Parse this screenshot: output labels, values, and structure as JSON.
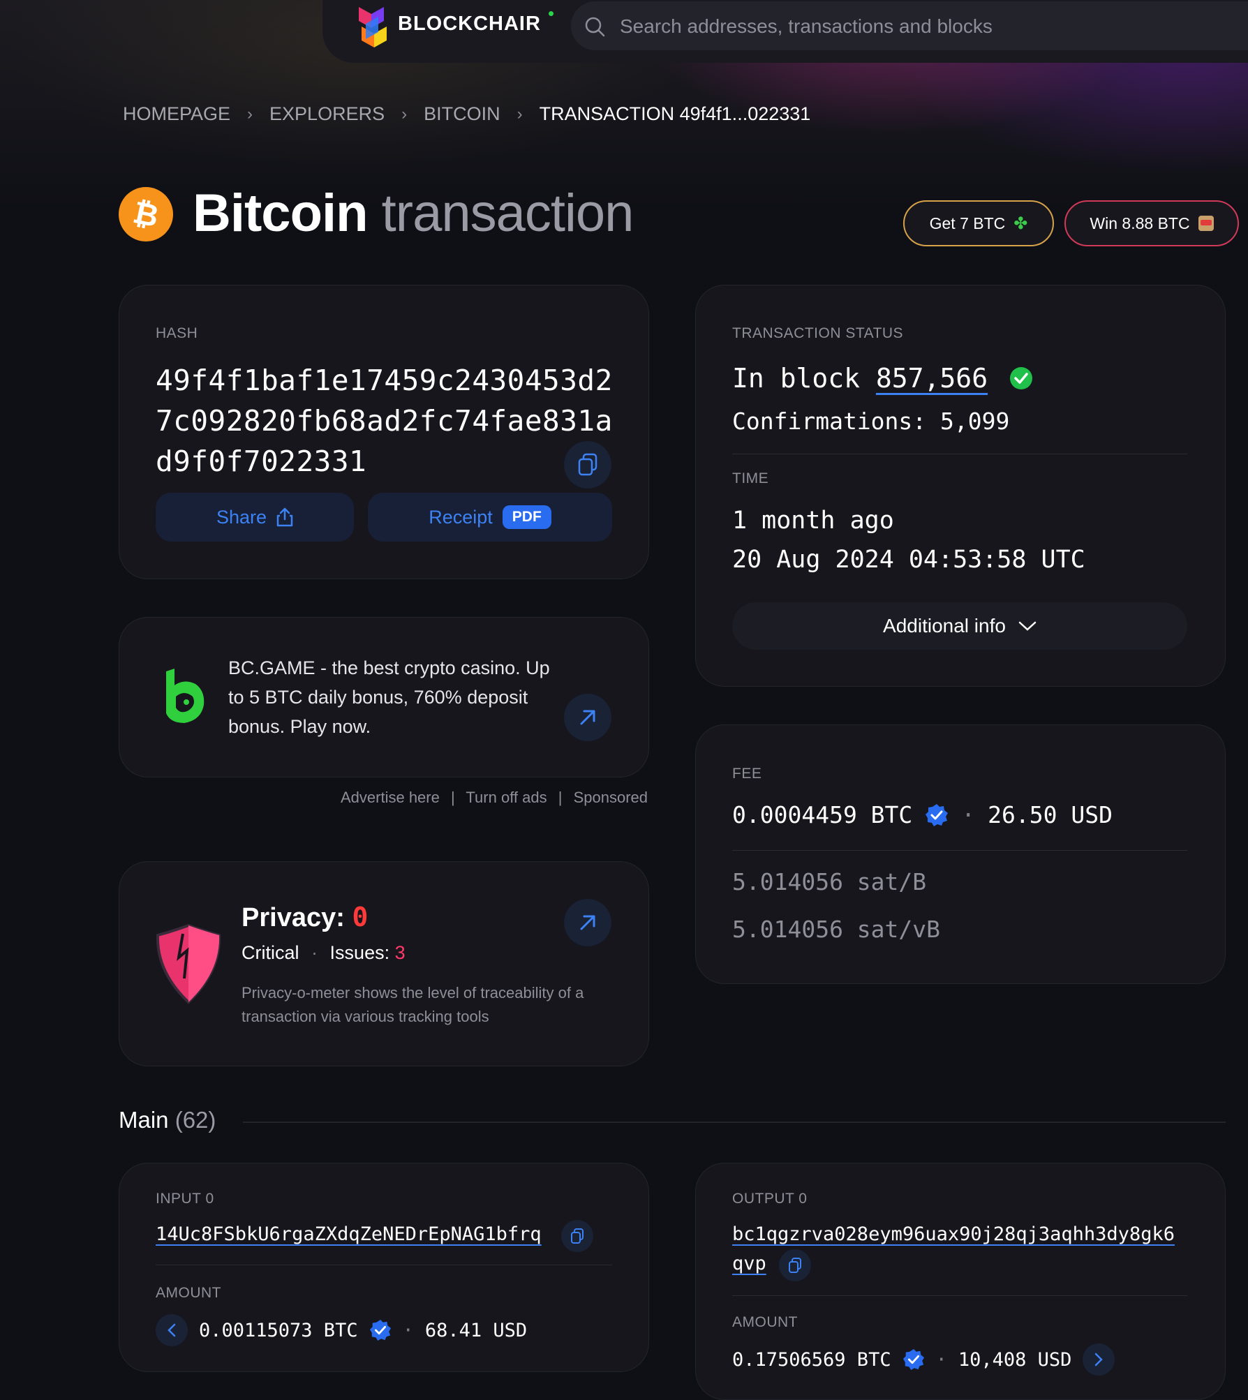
{
  "header": {
    "brand": "BLOCKCHAIR",
    "search_placeholder": "Search addresses, transactions and blocks"
  },
  "breadcrumb": [
    "HOMEPAGE",
    "EXPLORERS",
    "BITCOIN",
    "TRANSACTION 49f4f1...022331"
  ],
  "title": {
    "main": "Bitcoin",
    "sub": "transaction"
  },
  "promo": {
    "get": {
      "label": "Get 7 BTC",
      "icon": "clover-icon"
    },
    "win": {
      "label": "Win 8.88 BTC",
      "icon": "slot-machine-icon"
    }
  },
  "hash_card": {
    "label": "HASH",
    "hash": "49f4f1baf1e17459c2430453d27c092820fb68ad2fc74fae831ad9f0f7022331",
    "share_label": "Share",
    "receipt_label": "Receipt",
    "pdf_badge": "PDF"
  },
  "ad": {
    "text": "BC.GAME - the best crypto casino. Up to 5 BTC daily bonus, 760% deposit bonus. Play now.",
    "advertise": "Advertise here",
    "turn_off": "Turn off ads",
    "sponsored": "Sponsored",
    "divider": "|"
  },
  "privacy": {
    "label": "Privacy:",
    "score": "0",
    "level": "Critical",
    "dot": "·",
    "issues_label": "Issues:",
    "issues_count": "3",
    "description": "Privacy-o-meter shows the level of traceability of a transaction via various tracking tools"
  },
  "status_card": {
    "label": "TRANSACTION STATUS",
    "in_block_prefix": "In block",
    "block": "857,566",
    "confirmations": "Confirmations: 5,099",
    "time_label": "TIME",
    "relative": "1 month ago",
    "absolute": "20 Aug 2024 04:53:58 UTC",
    "additional_info": "Additional info"
  },
  "fee_card": {
    "label": "FEE",
    "btc": "0.0004459 BTC",
    "usd": "26.50 USD",
    "sat_per_b": "5.014056 sat/B",
    "sat_per_vb": "5.014056 sat/vB",
    "sep": "·"
  },
  "main_section": {
    "label": "Main",
    "count": "(62)"
  },
  "input0": {
    "label": "INPUT 0",
    "address": "14Uc8FSbkU6rgaZXdqZeNEDrEpNAG1bfrq",
    "amount_label": "AMOUNT",
    "btc": "0.00115073 BTC",
    "usd": "68.41 USD",
    "sep": "·"
  },
  "output0": {
    "label": "OUTPUT 0",
    "address_line1": "bc1qgzrva028eym96uax90j28qj3aqhh3dy8gk6",
    "address_line2": "qvp",
    "amount_label": "AMOUNT",
    "btc": "0.17506569 BTC",
    "usd": "10,408 USD",
    "sep": "·"
  },
  "colors": {
    "background": "#0f1016",
    "accent_blue": "#3d82f5",
    "success_green": "#20c04a",
    "bitcoin_orange": "#f7931a",
    "danger_red": "#ff3a3a"
  }
}
